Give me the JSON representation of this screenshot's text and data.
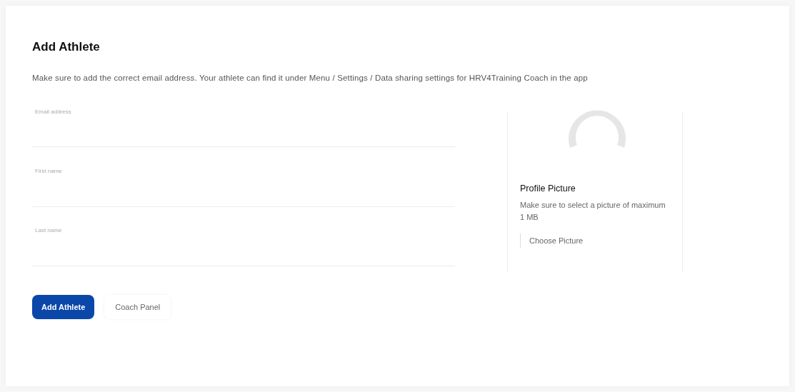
{
  "title": "Add Athlete",
  "description": "Make sure to add the correct email address. Your athlete can find it under Menu / Settings / Data sharing settings for HRV4Training Coach in the app",
  "fields": [
    {
      "placeholder": "Email address"
    },
    {
      "placeholder": "First name"
    },
    {
      "placeholder": "Last name"
    }
  ],
  "profile_picture": {
    "title": "Profile Picture",
    "hint": "Make sure to select a picture of maximum 1 MB",
    "button": "Choose Picture"
  },
  "buttons": [
    {
      "label": "Add Athlete",
      "kind": "primary"
    },
    {
      "label": "Coach Panel",
      "kind": "secondary"
    }
  ]
}
